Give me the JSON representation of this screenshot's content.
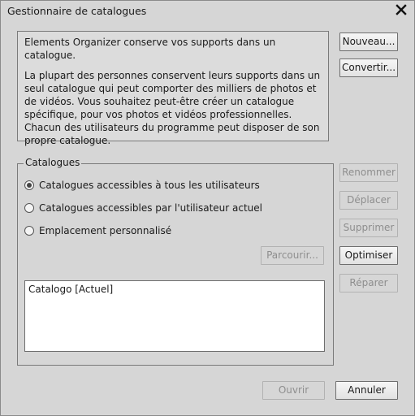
{
  "window": {
    "title": "Gestionnaire de catalogues"
  },
  "info": {
    "line1": "Elements Organizer conserve vos supports dans un catalogue.",
    "paragraph2": "La plupart des personnes conservent leurs supports dans un seul catalogue qui peut comporter des milliers de photos et de vidéos. Vous souhaitez peut-être créer un catalogue spécifique, pour vos photos et vidéos professionnelles. Chacun des utilisateurs du programme peut disposer de son propre catalogue."
  },
  "buttons": {
    "new": "Nouveau...",
    "convert": "Convertir...",
    "rename": "Renommer",
    "move": "Déplacer",
    "delete": "Supprimer",
    "optimize": "Optimiser",
    "repair": "Réparer",
    "browse": "Parcourir...",
    "open": "Ouvrir",
    "cancel": "Annuler"
  },
  "catalogs": {
    "group_label": "Catalogues",
    "options": [
      {
        "label": "Catalogues accessibles à tous les utilisateurs",
        "selected": true
      },
      {
        "label": "Catalogues accessibles par l'utilisateur actuel",
        "selected": false
      },
      {
        "label": "Emplacement personnalisé",
        "selected": false
      }
    ],
    "list": [
      "Catalogo [Actuel]"
    ]
  },
  "icons": {
    "close": "close-icon"
  }
}
